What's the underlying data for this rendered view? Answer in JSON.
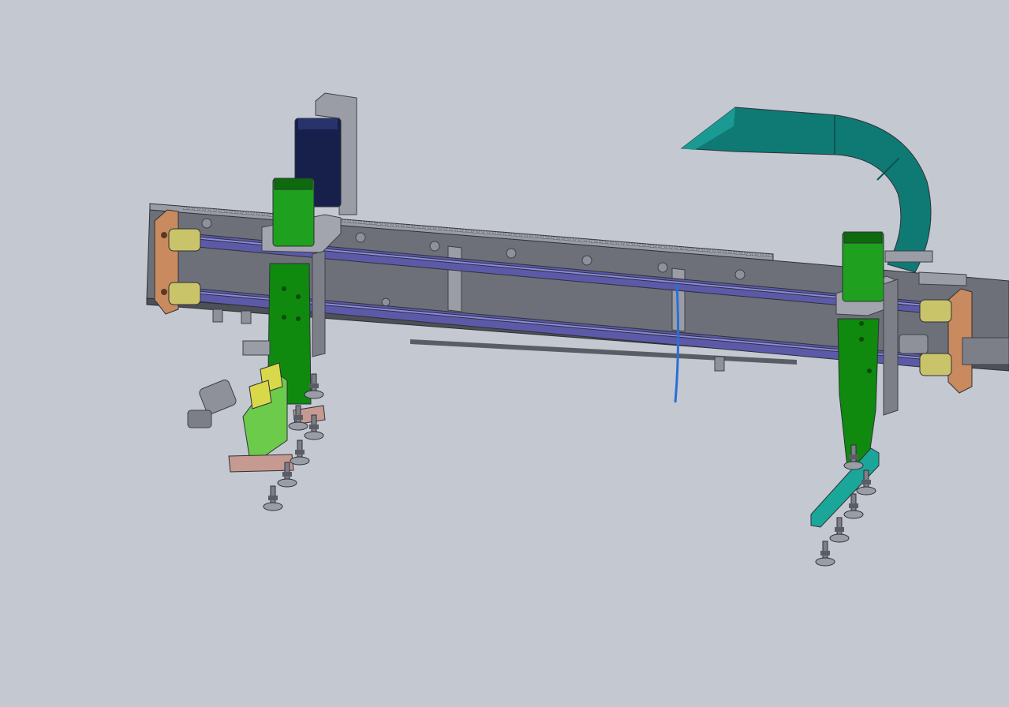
{
  "viewport": {
    "background": "#c4c8d0",
    "model": {
      "colors": {
        "frame": "#6d7079",
        "frame_dark": "#4e5058",
        "frame_light": "#9a9da6",
        "rod": "#5c5aa8",
        "rod_highlight": "#8c8ae0",
        "motor_green": "#1fa01f",
        "motor_green_dark": "#0d6b0d",
        "carriage_green": "#0f8a0f",
        "bracket_copper": "#c88a5e",
        "bushing_yellow": "#c9c36a",
        "cable_chain_teal": "#0f7a74",
        "teal_plate": "#1aa79a",
        "motor_navy": "#16204a",
        "yellow_block": "#d8d84a",
        "light_green_plate": "#6ccb4a",
        "pink_plate": "#c69a90",
        "sensor_blue": "#2a6fd6"
      }
    }
  }
}
